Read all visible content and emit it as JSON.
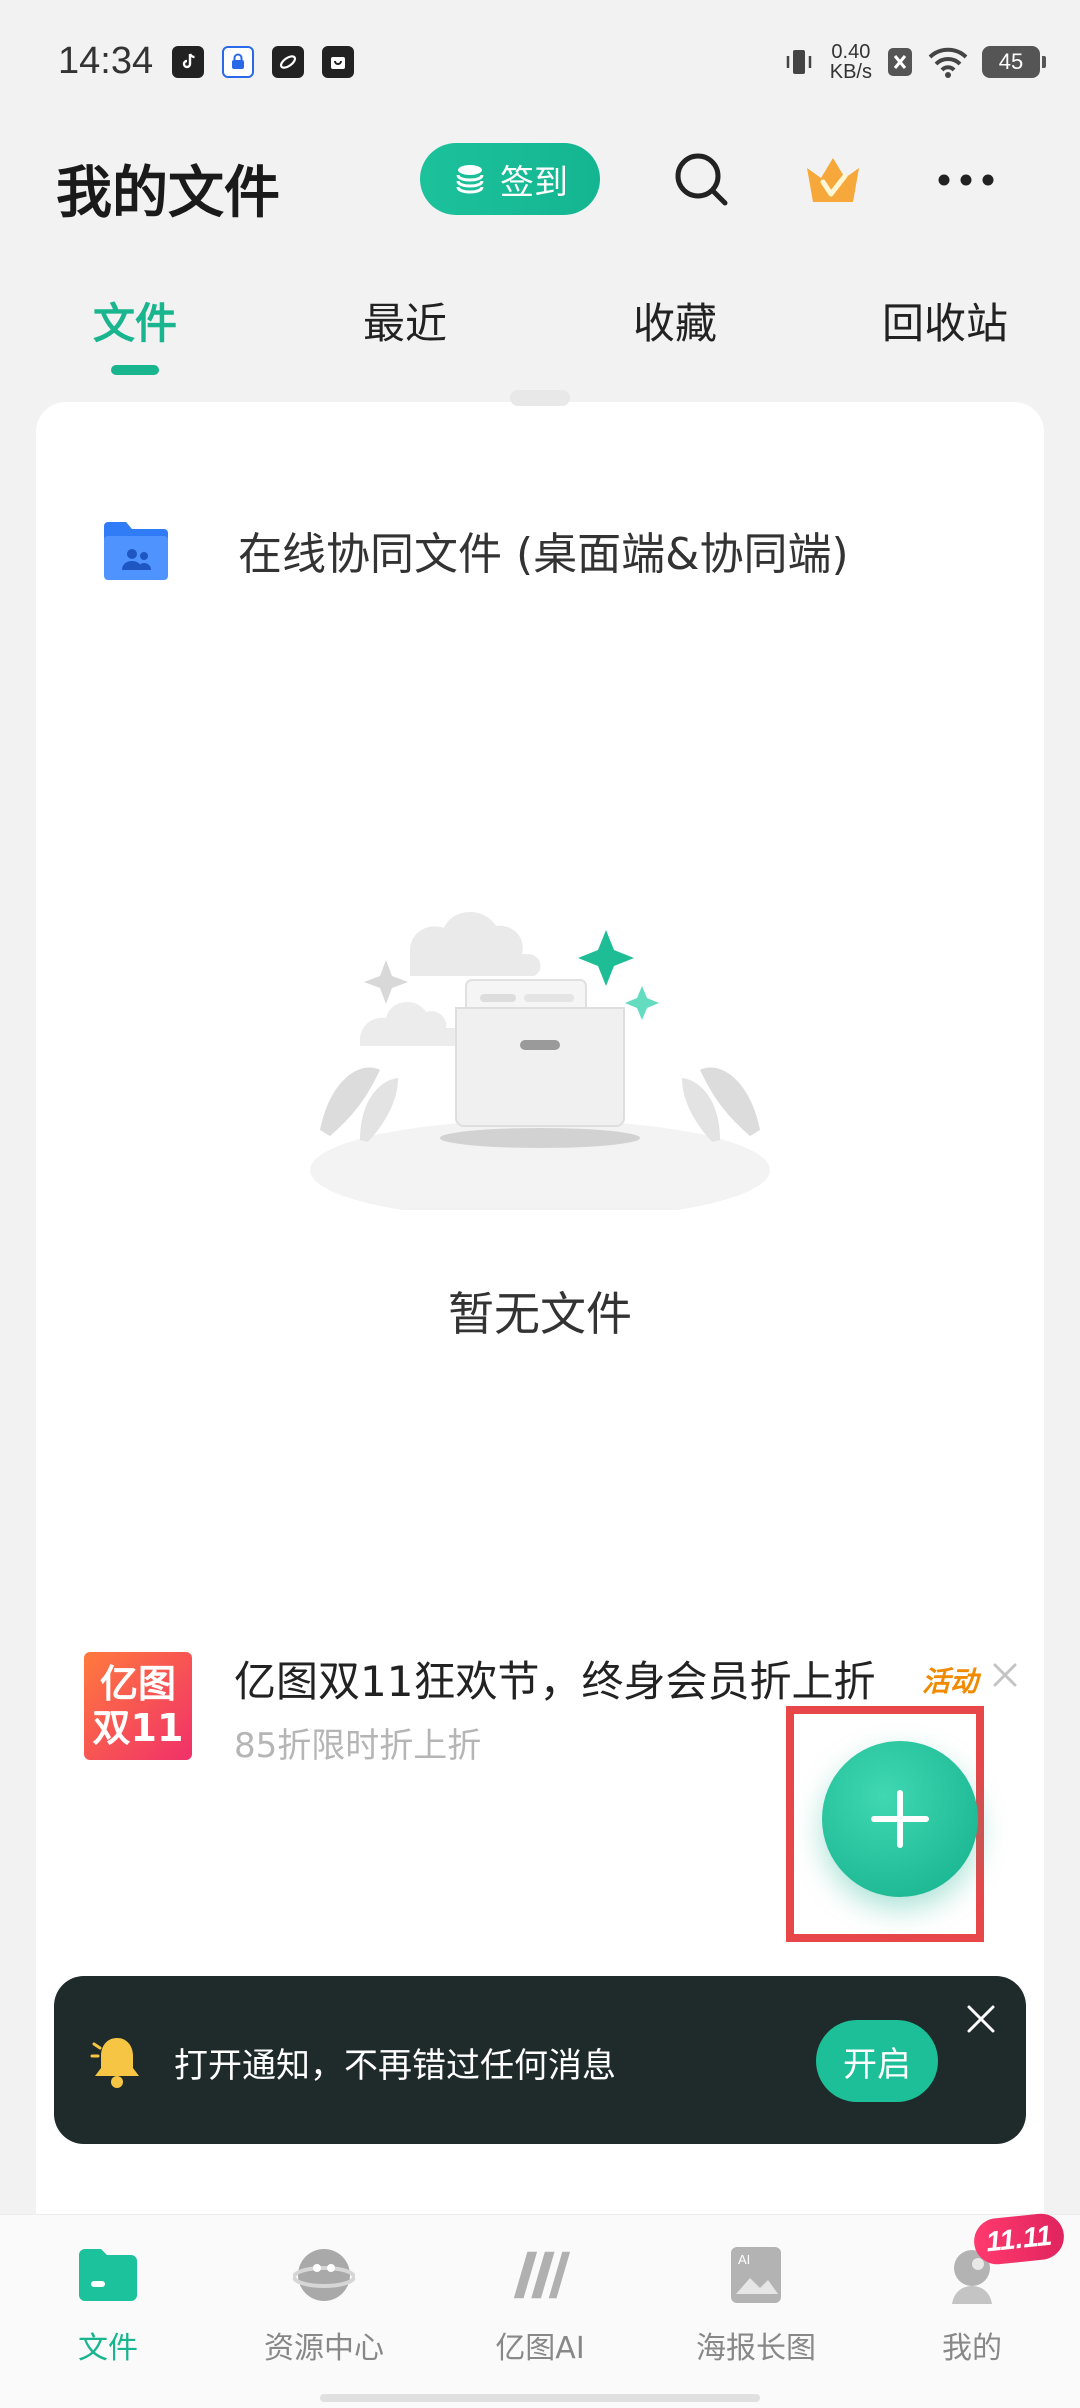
{
  "status_bar": {
    "time": "14:34",
    "net_speed_value": "0.40",
    "net_speed_unit": "KB/s",
    "battery": "45"
  },
  "header": {
    "title": "我的文件",
    "checkin_label": "签到"
  },
  "tabs": [
    {
      "label": "文件",
      "active": true
    },
    {
      "label": "最近",
      "active": false
    },
    {
      "label": "收藏",
      "active": false
    },
    {
      "label": "回收站",
      "active": false
    }
  ],
  "folder": {
    "label": "在线协同文件 (桌面端&协同端)",
    "icon": "shared-folder-icon"
  },
  "empty_state": {
    "text": "暂无文件"
  },
  "promo": {
    "logo_line1": "亿图",
    "logo_line2": "双11",
    "title": "亿图双11狂欢节，终身会员折上折",
    "subtitle": "85折限时折上折",
    "tag": "活动"
  },
  "notification": {
    "text": "打开通知，不再错过任何消息",
    "button": "开启"
  },
  "bottom_nav": [
    {
      "label": "文件",
      "icon": "files-icon",
      "active": true
    },
    {
      "label": "资源中心",
      "icon": "resource-center-icon",
      "active": false
    },
    {
      "label": "亿图AI",
      "icon": "ai-icon",
      "active": false
    },
    {
      "label": "海报长图",
      "icon": "poster-icon",
      "active": false
    },
    {
      "label": "我的",
      "icon": "profile-icon",
      "active": false
    }
  ],
  "badge": "11.11",
  "colors": {
    "accent": "#18b58f",
    "notification_bg": "#1f2b2a",
    "promo_tag": "#f08a00",
    "highlight": "#e8474a"
  }
}
